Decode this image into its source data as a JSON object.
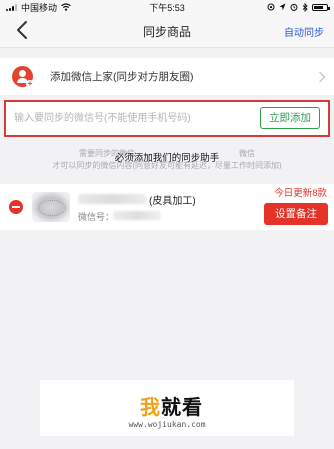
{
  "status_bar": {
    "carrier": "中国移动",
    "time": "下午5:53",
    "battery_level": 0.75
  },
  "nav": {
    "title": "同步商品",
    "right_action": "自动同步",
    "back_icon": "chevron-left-icon"
  },
  "add_contact": {
    "label": "添加微信上家(同步对方朋友圈)",
    "icon": "add-user-icon",
    "accent_color": "#e3442f"
  },
  "wechat_input": {
    "placeholder": "输入要同步的微信号(不能使用手机号码)",
    "value": "",
    "button_label": "立即添加",
    "button_color": "#2f9f4f",
    "highlight_color": "#d43a3a"
  },
  "notice": {
    "faint_line1": "需要同步的微信……",
    "strong_text": "必须添加我们的同步助手",
    "faint_line1_suffix": "微信",
    "faint_line2": "才可以同步的微信内容(同意好友可能有延迟，尽量工作时间添加)"
  },
  "contacts": [
    {
      "name_suffix": "(皮具加工)",
      "wechat_label": "微信号：",
      "update_text": "今日更新8款",
      "note_button": "设置备注"
    }
  ],
  "brand": {
    "danger_color": "#e5332a"
  },
  "watermark": {
    "logo_accent": "我",
    "logo_rest": "就看",
    "url": "www.wojiukan.com"
  }
}
